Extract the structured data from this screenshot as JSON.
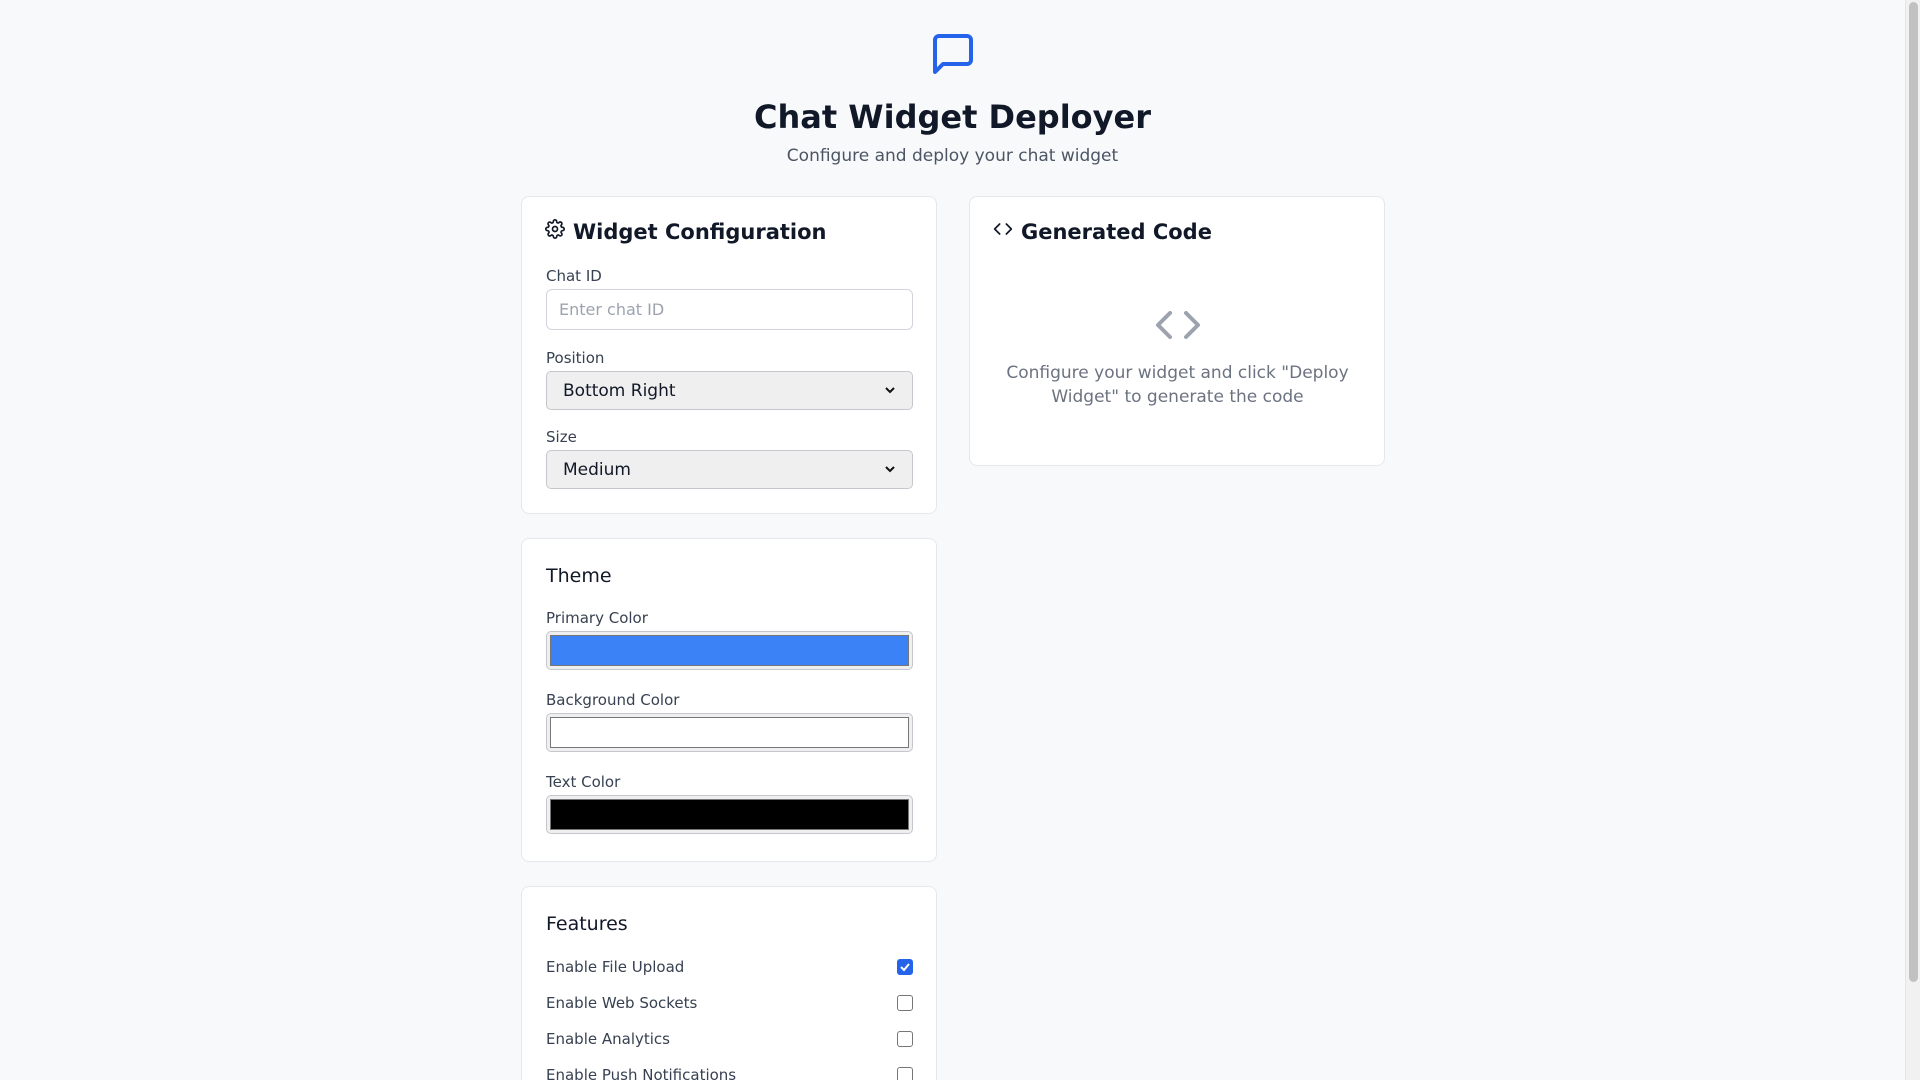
{
  "header": {
    "icon": "message-square-icon",
    "title": "Chat Widget Deployer",
    "subtitle": "Configure and deploy your chat widget"
  },
  "config": {
    "title": "Widget Configuration",
    "icon": "gear-icon",
    "chat_id_label": "Chat ID",
    "chat_id_placeholder": "Enter chat ID",
    "chat_id_value": "",
    "position_label": "Position",
    "position_value": "Bottom Right",
    "size_label": "Size",
    "size_value": "Medium"
  },
  "theme": {
    "title": "Theme",
    "primary_label": "Primary Color",
    "primary_color": "#3b82f6",
    "background_label": "Background Color",
    "background_color": "#ffffff",
    "text_label": "Text Color",
    "text_color": "#000000"
  },
  "features": {
    "title": "Features",
    "items": [
      {
        "label": "Enable File Upload",
        "checked": true
      },
      {
        "label": "Enable Web Sockets",
        "checked": false
      },
      {
        "label": "Enable Analytics",
        "checked": false
      },
      {
        "label": "Enable Push Notifications",
        "checked": false
      }
    ]
  },
  "code": {
    "title": "Generated Code",
    "icon": "code-icon",
    "placeholder_icon": "code-brackets-icon",
    "placeholder_text": "Configure your widget and click \"Deploy Widget\" to generate the code"
  }
}
